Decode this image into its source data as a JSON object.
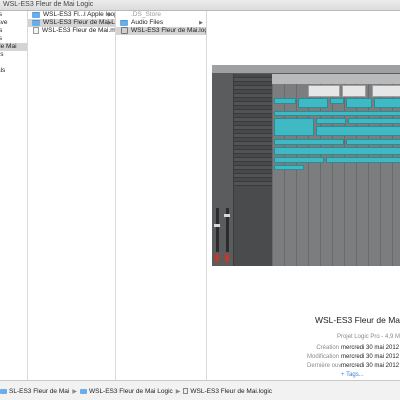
{
  "window": {
    "title": "WSL-ES3 Fleur de Mai Logic"
  },
  "column1": {
    "items": [
      {
        "label": "ts",
        "selected": false
      },
      {
        "label": "ave",
        "selected": false
      },
      {
        "label": "rs",
        "selected": false
      },
      {
        "label": "ts",
        "selected": false
      },
      {
        "label": "de Mai",
        "selected": true
      },
      {
        "label": "ss",
        "selected": false
      },
      {
        "label": "s",
        "selected": false
      },
      {
        "label": "als",
        "selected": false
      }
    ]
  },
  "column2": {
    "items": [
      {
        "label": "WSL-ES3 Fl...l Apple loops",
        "icon": "folder",
        "selected": false,
        "has_children": true
      },
      {
        "label": "WSL-ES3 Fleur de Mai Logic",
        "icon": "folder",
        "selected": true,
        "has_children": true
      },
      {
        "label": "WSL-ES3 Fleur de Mai.mid",
        "icon": "doc",
        "selected": false,
        "has_children": false
      }
    ]
  },
  "column3": {
    "items": [
      {
        "label": ".DS_Store",
        "icon": "none",
        "selected": false,
        "dim": true,
        "has_children": false
      },
      {
        "label": "Audio Files",
        "icon": "folder",
        "selected": false,
        "dim": false,
        "has_children": true
      },
      {
        "label": "WSL-ES3 Fleur de Mai.logic",
        "icon": "logic",
        "selected": true,
        "dim": false,
        "has_children": false
      }
    ]
  },
  "preview": {
    "file_name": "WSL-ES3 Fleur de Ma",
    "kind": "Projet Logic Pro - 4,9 M",
    "meta": [
      {
        "key": "Création",
        "value": "mercredi 30 mai 2012 1"
      },
      {
        "key": "Modification",
        "value": "mercredi 30 mai 2012 1"
      },
      {
        "key": "Dernière ouv.",
        "value": "mercredi 30 mai 2012 1"
      }
    ],
    "tags_label": "+ Tags..."
  },
  "pathbar": {
    "crumbs": [
      {
        "label": "SL-ES3 Fleur de Mai",
        "icon": "folder"
      },
      {
        "label": "WSL-ES3 Fleur de Mai Logic",
        "icon": "folder"
      },
      {
        "label": "WSL-ES3 Fleur de Mai.logic",
        "icon": "doc"
      }
    ]
  },
  "colors": {
    "selection": "#d4d4d4",
    "folder": "#6aaee9",
    "region_cyan": "#3fb9c4",
    "link": "#3b7fd6"
  }
}
